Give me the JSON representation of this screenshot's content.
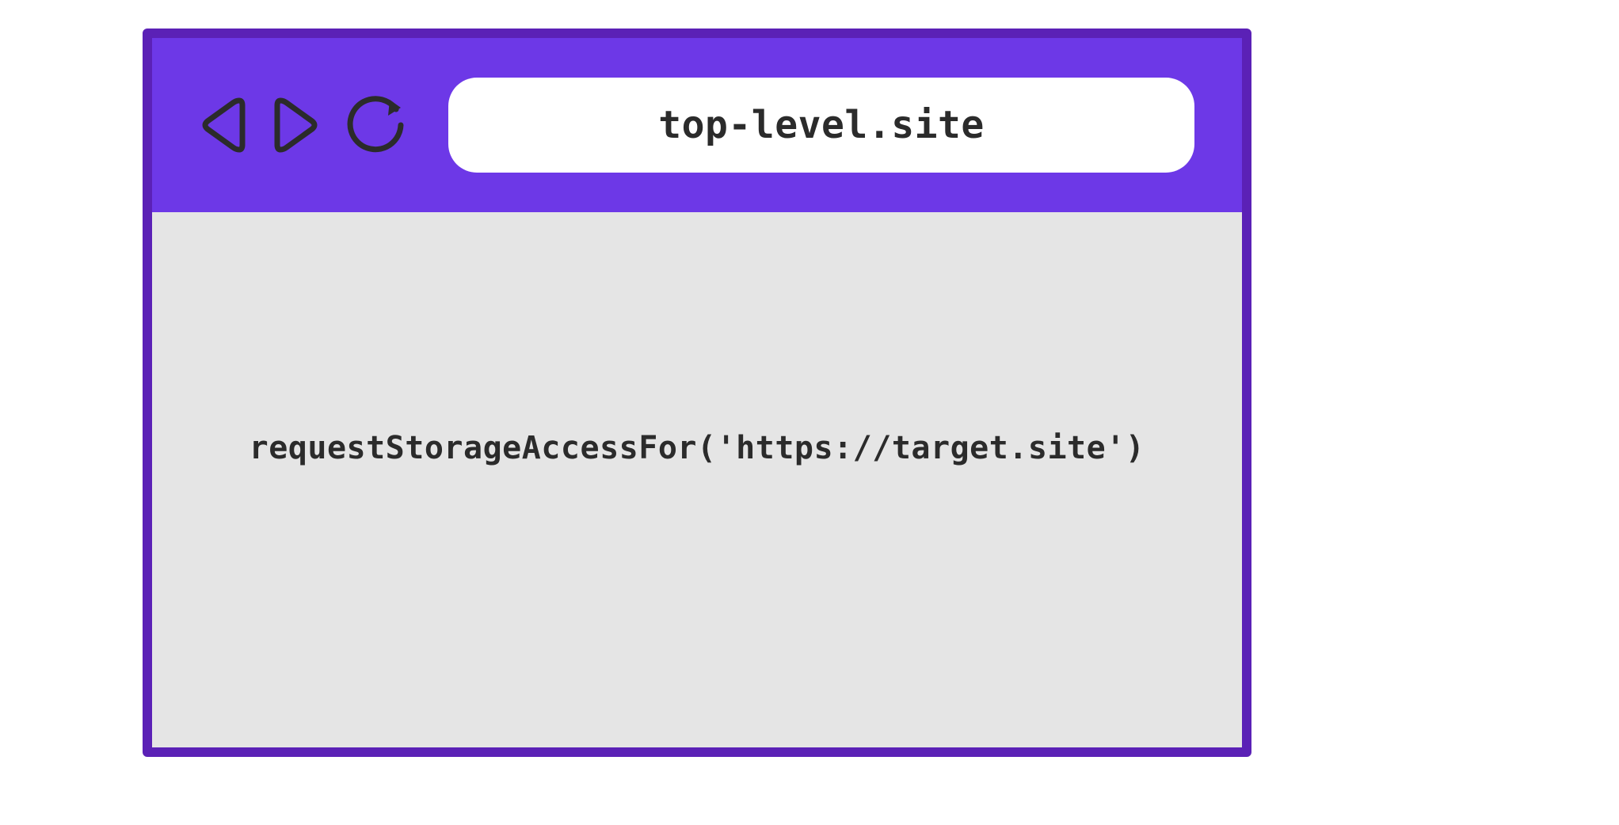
{
  "browser": {
    "address_bar": "top-level.site",
    "content_code": "requestStorageAccessFor('https://target.site')"
  },
  "colors": {
    "toolbar": "#6d38e7",
    "border": "#5b21b6",
    "content_bg": "#e5e5e5",
    "text": "#2b2b2b",
    "icon_stroke": "#2b2b2b"
  },
  "icons": {
    "back": "back-icon",
    "forward": "forward-icon",
    "reload": "reload-icon"
  }
}
